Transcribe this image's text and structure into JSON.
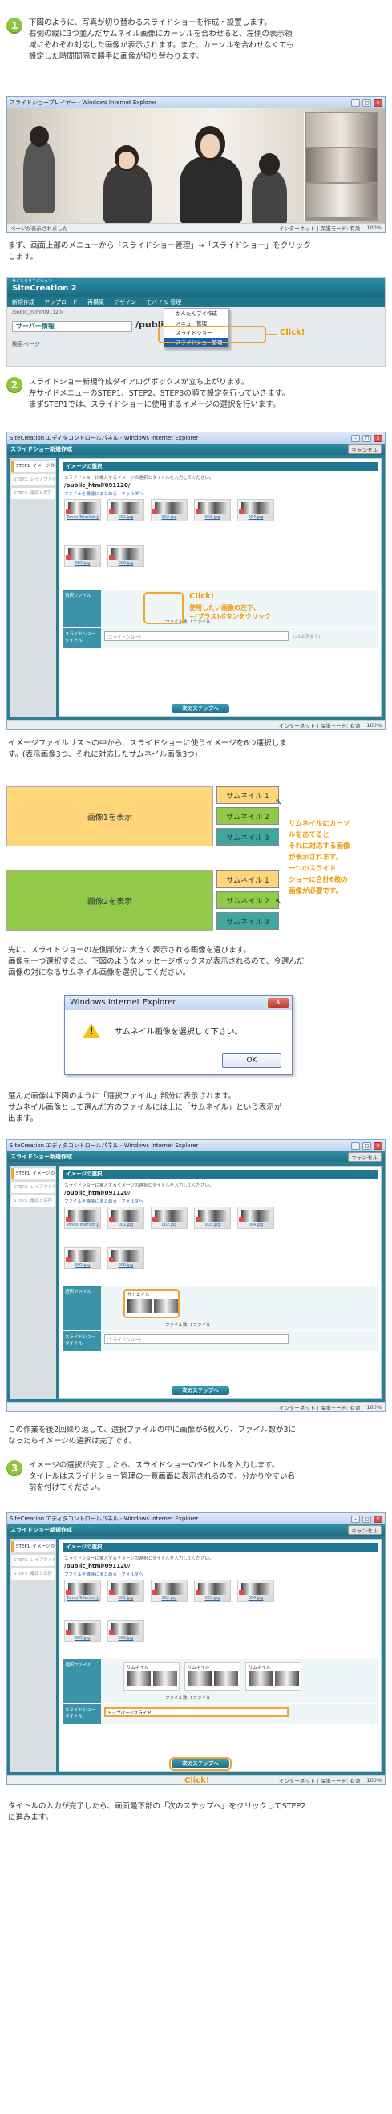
{
  "step1": {
    "num": "1",
    "lines": [
      "下図のように、写真が切り替わるスライドショーを作成・設置します。",
      "右側の縦に3つ並んだサムネイル画像にカーソルを合わせると、左側の表示領",
      "域にそれぞれ対応した画像が表示されます。また、カーソルを合わせなくても",
      "設定した時間間隔で勝手に画像が切り替わります。"
    ]
  },
  "player_win": {
    "title": "スライドショープレイヤー - Windows Internet Explorer",
    "status_left": "ページが表示されました",
    "status_mid": "インターネット | 保護モード: 有効",
    "zoom": "100%"
  },
  "para_menu": {
    "lines": [
      "まず、画面上部のメニューから「スライドショー管理」→「スライドショー」をクリック",
      "します。"
    ]
  },
  "menu_shot": {
    "logo_small": "サイトクリエイション",
    "logo": "SiteCreation 2",
    "bar": [
      "新規作成",
      "アップロード",
      "再構築",
      "デザイン",
      "モバイル 管理"
    ],
    "left_item": "サーバー情報",
    "left_item2": "検索ページ",
    "path_label": "/public_html/091120/",
    "path_big": "/public_ht",
    "dropdown": [
      "かんたんブイ作成",
      "メニュー管理",
      "スライドショー",
      "スライドショー管理"
    ],
    "click": "Click!"
  },
  "step2": {
    "num": "2",
    "lines": [
      "スライドショー新規作成ダイアログボックスが立ち上がります。",
      "左サイドメニューのSTEP1、STEP2、STEP3の順で設定を行っていきます。",
      "まずSTEP1では、スライドショーに使用するイメージの選択を行います。"
    ]
  },
  "app_win": {
    "title": "SiteCreation エディタコントロールパネル - Windows Internet Explorer",
    "header": "スライドショー新規作成",
    "cancel": "キャンセル",
    "nav": [
      "STEP1. イメージの選択",
      "STEP2. レイアウトの選択",
      "STEP3. 確認と保存"
    ],
    "section": "イメージの選択",
    "hint": "スライドショーに挿入するイメージの選択とタイトルを入力してください。",
    "path": "/public_html/091120/",
    "upload": "ファイルを機能にまとめる",
    "upload2": "フォルダへ",
    "thumbs": [
      "Tonos Tolerism.jpg",
      "001.jpg",
      "002.jpg",
      "003.jpg",
      "004.jpg",
      "005.jpg",
      "006.jpg"
    ],
    "lbl_files": "選択ファイル",
    "lbl_title": "スライドショータイトル",
    "file_count": "ファイル数: 1ファイル",
    "title_ph": "(スライドショー)",
    "title_note": "(25文字まで)",
    "next": "次のステップへ",
    "status_mid": "インターネット | 保護モード: 有効",
    "zoom": "100%"
  },
  "click_note1": {
    "click": "Click!",
    "lines": [
      "使用したい画像の左下、",
      "+(プラス)ボタンをクリック"
    ]
  },
  "para_list": {
    "lines": [
      "イメージファイルリストの中から、スライドショーに使うイメージを6つ選択しま",
      "す。(表示画像3つ、それに対応したサムネイル画像3つ)"
    ]
  },
  "thumb_demo": {
    "img1": "画像1を表示",
    "img2": "画像2を表示",
    "t": [
      "サムネイル 1",
      "サムネイル 2",
      "サムネイル 3"
    ],
    "note": [
      "サムネイルにカーソ",
      "ルをあてると",
      "それに対応する画像",
      "が表示されます。",
      "一つのスライド",
      "ショーに合計6枚の",
      "画像が必要です。"
    ],
    "colors": {
      "yellow": "#ffd77a",
      "green": "#92c94a",
      "teal": "#3fa6a0"
    }
  },
  "para_select": {
    "lines": [
      "先に、スライドショーの左側部分に大きく表示される画像を選びます。",
      "画像を一つ選択すると、下図のようなメッセージボックスが表示されるので、今選んだ",
      "画像の対になるサムネイル画像を選択してください。"
    ]
  },
  "dialog": {
    "title": "Windows Internet Explorer",
    "message": "サムネイル画像を選択して下さい。",
    "ok": "OK",
    "close": "X"
  },
  "para_selected": {
    "lines": [
      "選んだ画像は下図のように「選択ファイル」部分に表示されます。",
      "サムネイル画像として選んだ方のファイルには上に「サムネイル」という表示が",
      "出ます。"
    ]
  },
  "sel_label": "サムネイル",
  "para_repeat": {
    "lines": [
      "この作業を後2回繰り返して、選択ファイルの中に画像が6枚入り、ファイル数が3に",
      "なったらイメージの選択は完了です。"
    ]
  },
  "step3": {
    "num": "3",
    "lines": [
      "イメージの選択が完了したら、スライドショーのタイトルを入力します。",
      "タイトルはスライドショー管理の一覧画面に表示されるので、分かりやすい名",
      "前を付けてください。"
    ]
  },
  "title_val": "トップページスライド",
  "para_final": {
    "lines": [
      "タイトルの入力が完了したら、画面最下部の「次のステップへ」をクリックしてSTEP2",
      "に進みます。"
    ]
  }
}
